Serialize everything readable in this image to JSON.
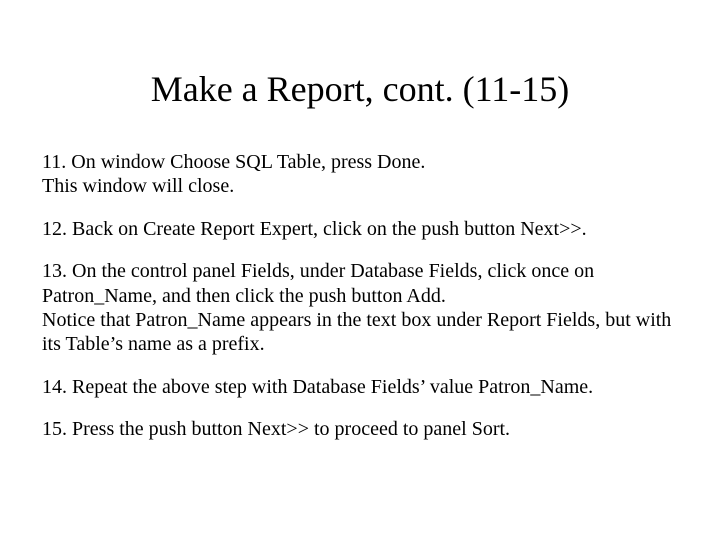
{
  "title": "Make a Report, cont. (11-15)",
  "items": [
    "11. On window Choose SQL Table, press  Done.\nThis window will close.",
    "12. Back on Create Report Expert, click on the push button Next>>.",
    "13. On the control panel Fields, under Database Fields, click once on Patron_Name, and then click the push button Add.\nNotice that Patron_Name appears in the text box under Report Fields, but with its Table’s name as a prefix.",
    "14. Repeat the above step with Database Fields’ value Patron_Name.",
    "15. Press the push button Next>> to proceed to panel Sort."
  ]
}
